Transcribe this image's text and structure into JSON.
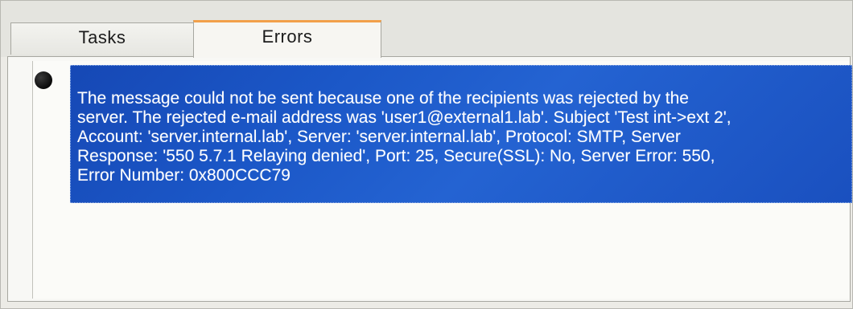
{
  "tabs": [
    {
      "label": "Tasks",
      "selected": false
    },
    {
      "label": "Errors",
      "selected": true
    }
  ],
  "errors": [
    {
      "message": "The message could not be sent because one of the recipients was rejected by the\nserver. The rejected e-mail address was 'user1@external1.lab'. Subject 'Test int->ext 2',\nAccount: 'server.internal.lab', Server: 'server.internal.lab', Protocol: SMTP, Server\nResponse: '550 5.7.1 Relaying denied', Port: 25, Secure(SSL): No, Server Error: 550,\nError Number: 0x800CCC79",
      "icon": "error-bullet-icon",
      "selected": true
    }
  ],
  "colors": {
    "selection": "#1b57c7",
    "tab_highlight": "#f2a04a",
    "background": "#ecebe6"
  }
}
